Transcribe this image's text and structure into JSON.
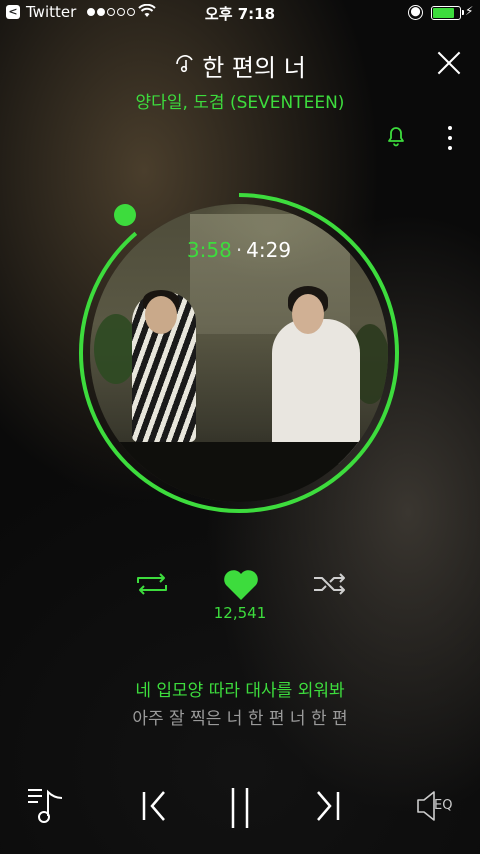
{
  "status_bar": {
    "back_app": "Twitter",
    "back_chip": "<",
    "time": "오후 7:18",
    "signal_dots_filled": 2,
    "signal_dots_total": 5,
    "battery_level": 0.8
  },
  "header": {
    "title": "한 편의 너",
    "artist": "양다일, 도겸 (SEVENTEEN)"
  },
  "player": {
    "elapsed": "3:58",
    "separator": "·",
    "duration": "4:29",
    "progress": 0.886
  },
  "controls": {
    "like_count": "12,541"
  },
  "lyrics": {
    "current": "네 입모양 따라 대사를 외워봐",
    "next": "아주 잘 찍은 너 한 편 너 한 편"
  },
  "bottom_bar": {
    "eq_label": "EQ"
  },
  "colors": {
    "accent": "#3ddc3d",
    "text": "#ffffff",
    "muted": "#9a9a9a"
  },
  "icons": [
    "close-icon",
    "bell-icon",
    "more-icon",
    "repeat-icon",
    "heart-icon",
    "shuffle-icon",
    "playlist-icon",
    "previous-icon",
    "pause-icon",
    "next-icon",
    "eq-icon"
  ]
}
